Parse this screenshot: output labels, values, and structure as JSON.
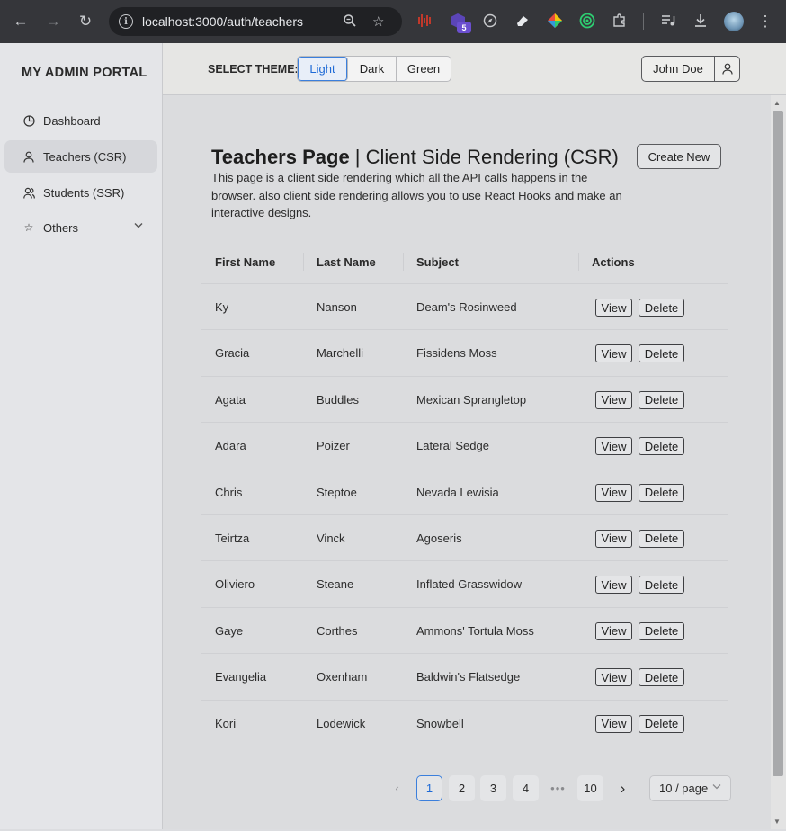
{
  "browser": {
    "url": "localhost:3000/auth/teachers",
    "ext_badge": "5"
  },
  "sidebar": {
    "brand": "MY ADMIN PORTAL",
    "items": [
      {
        "label": "Dashboard",
        "icon": "pie-chart-icon"
      },
      {
        "label": "Teachers (CSR)",
        "icon": "user-icon"
      },
      {
        "label": "Students (SSR)",
        "icon": "users-icon"
      },
      {
        "label": "Others",
        "icon": "star-icon"
      }
    ]
  },
  "header": {
    "theme_label": "SELECT THEME:",
    "themes": [
      "Light",
      "Dark",
      "Green"
    ],
    "selected_theme": "Light",
    "user_name": "John Doe"
  },
  "page": {
    "title_bold": "Teachers Page",
    "title_rest": " | Client Side Rendering (CSR)",
    "description": "This page is a client side rendering which all the API calls happens in the browser. also client side rendering allows you to use React Hooks and make an interactive designs.",
    "create_label": "Create New"
  },
  "table": {
    "headers": [
      "First Name",
      "Last Name",
      "Subject",
      "Actions"
    ],
    "view_label": "View",
    "delete_label": "Delete",
    "rows": [
      [
        "Ky",
        "Nanson",
        "Deam's Rosinweed"
      ],
      [
        "Gracia",
        "Marchelli",
        "Fissidens Moss"
      ],
      [
        "Agata",
        "Buddles",
        "Mexican Sprangletop"
      ],
      [
        "Adara",
        "Poizer",
        "Lateral Sedge"
      ],
      [
        "Chris",
        "Steptoe",
        "Nevada Lewisia"
      ],
      [
        "Teirtza",
        "Vinck",
        "Agoseris"
      ],
      [
        "Oliviero",
        "Steane",
        "Inflated Grasswidow"
      ],
      [
        "Gaye",
        "Corthes",
        "Ammons' Tortula Moss"
      ],
      [
        "Evangelia",
        "Oxenham",
        "Baldwin's Flatsedge"
      ],
      [
        "Kori",
        "Lodewick",
        "Snowbell"
      ]
    ]
  },
  "pagination": {
    "pages": [
      "1",
      "2",
      "3",
      "4"
    ],
    "ellipsis": "•••",
    "last_page": "10",
    "current": "1",
    "page_size": "10 / page"
  },
  "colors": {
    "accent": "#1e6ad6",
    "chrome": "#35363a"
  }
}
